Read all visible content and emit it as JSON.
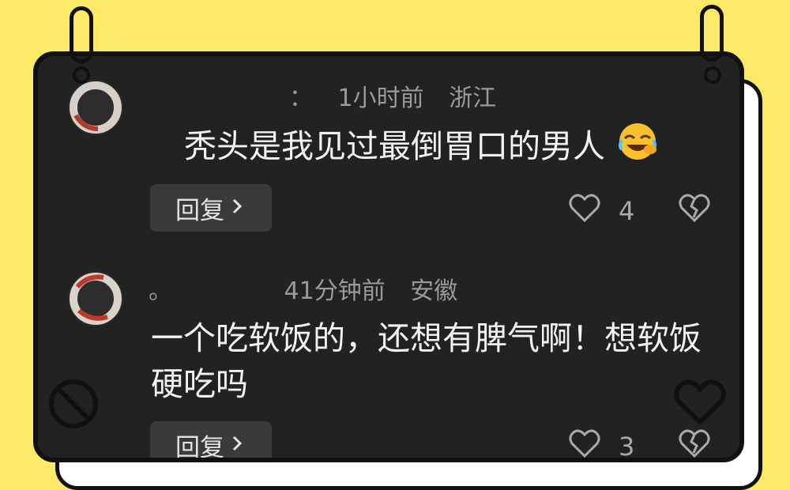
{
  "comments": [
    {
      "username": "：",
      "time": "1小时前",
      "location": "浙江",
      "text": "秃头是我见过最倒胃口的男人",
      "emoji": "rofl-emoji",
      "reply_label": "回复",
      "likes": "4"
    },
    {
      "username": "。",
      "time": "41分钟前",
      "location": "安徽",
      "text": "一个吃软饭的，还想有脾气啊！想软饭硬吃吗",
      "reply_label": "回复",
      "likes": "3"
    }
  ],
  "icons": {
    "like": "heart-outline-icon",
    "dislike": "broken-heart-icon",
    "reply_chevron": "chevron-right-icon",
    "corner_left": "block-icon",
    "corner_right": "heart-icon"
  },
  "colors": {
    "background": "#fde968",
    "card": "#222222",
    "text": "#f2f2f2",
    "meta": "#9a9a9a"
  }
}
